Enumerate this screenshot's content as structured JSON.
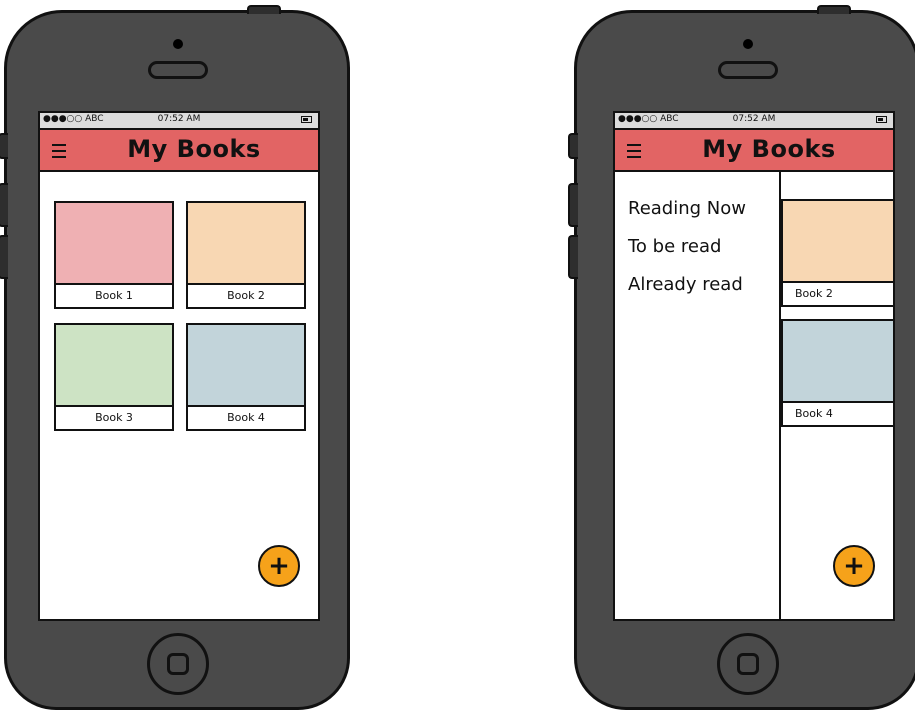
{
  "left_phone": {
    "status": {
      "carrier": "●●●○○ ABC",
      "time": "07:52 AM"
    },
    "app_title": "My Books",
    "books": [
      {
        "label": "Book 1",
        "color": "#efb0b3"
      },
      {
        "label": "Book 2",
        "color": "#f8d7b3"
      },
      {
        "label": "Book 3",
        "color": "#cde3c4"
      },
      {
        "label": "Book 4",
        "color": "#c2d4da"
      }
    ],
    "fab_symbol": "+"
  },
  "right_phone": {
    "status": {
      "carrier": "●●●○○ ABC",
      "time": "07:52 AM"
    },
    "app_title": "My Books",
    "drawer_items": [
      "Reading Now",
      "To be read",
      "Already read"
    ],
    "visible_books": [
      {
        "label": "Book 2",
        "color": "#f8d7b3"
      },
      {
        "label": "Book 4",
        "color": "#c2d4da"
      }
    ],
    "fab_symbol": "+"
  },
  "colors": {
    "appbar": "#e26464",
    "fab": "#f6a21a",
    "phone_body": "#4a4a4a"
  }
}
